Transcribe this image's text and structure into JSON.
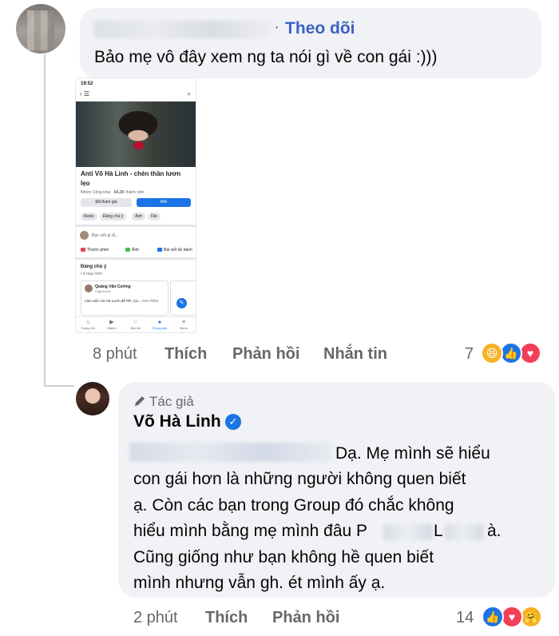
{
  "comment": {
    "follow_separator": "·",
    "follow_label": "Theo dõi",
    "text": "Bảo mẹ vô đây xem ng ta nói gì về con gái :)))",
    "time": "8 phút",
    "like_label": "Thích",
    "reply_label": "Phản hồi",
    "message_label": "Nhắn tin",
    "reaction_count": "7",
    "reactions": [
      "haha-icon",
      "like-icon",
      "love-icon"
    ]
  },
  "screenshot": {
    "status_time": "19:52",
    "group_title": "Anti Võ Hà Linh - chén thần lươn lẹo",
    "group_meta_type": "Nhóm Công khai",
    "group_meta_members": "64,2K",
    "group_meta_suffix": "thành viên",
    "joined_label": "Đã tham gia",
    "invite_label": "Mời",
    "chips": [
      "Reels",
      "Đáng chú ý",
      "Ảnh",
      "File"
    ],
    "composer_placeholder": "Bạn viết gì đi...",
    "actions": [
      "Thước phim",
      "Ảnh",
      "Bài viết ẩn danh"
    ],
    "featured_title": "Đáng chú ý",
    "featured_count": "• 6 mục mới",
    "card_name": "Quảng Văn Cường",
    "card_time": "4 giờ trước",
    "card_body": "Làm việc với Hà Lươn để PR, Ca...",
    "card_more": "Xem thêm",
    "tabs": [
      "Trang chủ",
      "Watch",
      "Bạn bè",
      "Thông báo",
      "Menu"
    ]
  },
  "reply": {
    "badge": "Tác giả",
    "name": "Võ Hà Linh",
    "lines": [
      "Dạ. Mẹ mình sẽ hiểu",
      "con gái hơn là những người không quen biết",
      "ạ. Còn các bạn trong Group đó chắc không",
      "hiểu mình bằng mẹ mình đâu P",
      "L",
      "à.",
      "Cũng giống như bạn không hề quen biết",
      "mình nhưng vẫn gh. ét mình ấy ạ."
    ],
    "time": "2 phút",
    "like_label": "Thích",
    "reply_label": "Phản hồi",
    "reaction_count": "14",
    "reactions": [
      "like-icon",
      "love-icon",
      "care-icon"
    ]
  }
}
